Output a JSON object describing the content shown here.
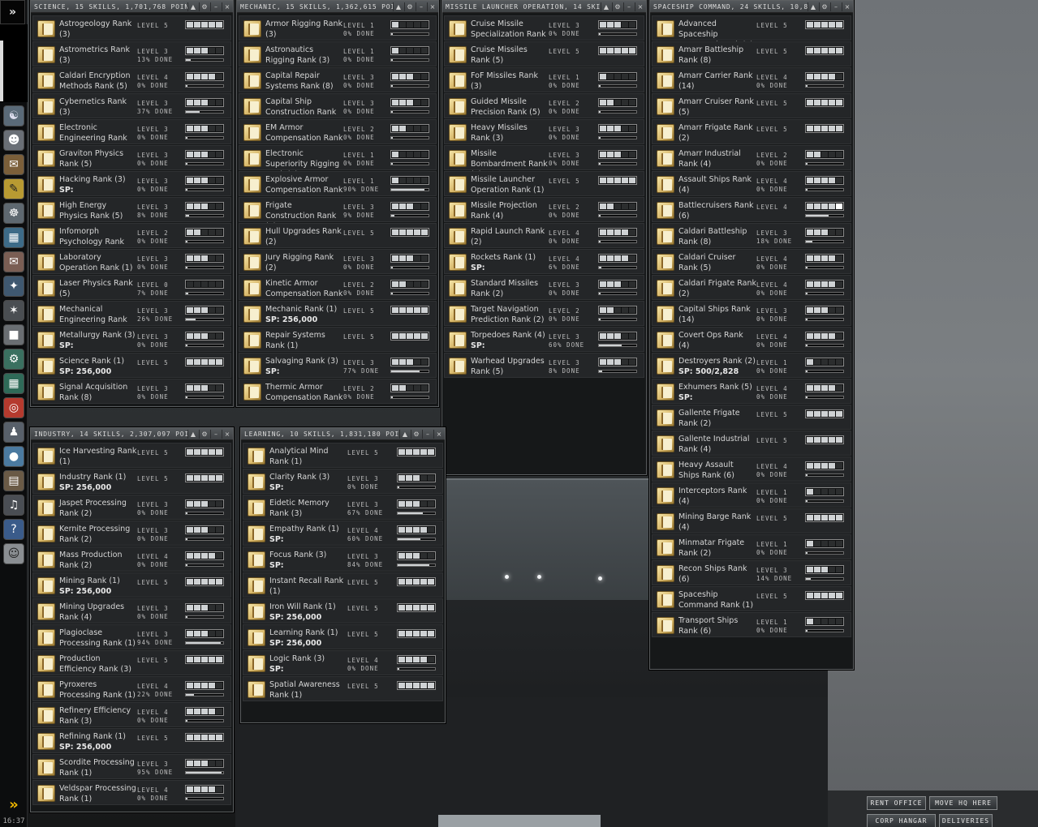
{
  "sidebar": {
    "toggle": "»",
    "clock": "16:37"
  },
  "hangar_buttons": {
    "rent_office": "RENT OFFICE",
    "move_hq": "MOVE HQ HERE",
    "corp_hangar": "CORP HANGAR",
    "deliveries": "DELIVERIES"
  },
  "windows": [
    {
      "key": "science",
      "title": "SCIENCE, 15 SKILLS, 1,701,768 POINTS",
      "skills": [
        {
          "name": "Astrogeology Rank (3)",
          "level": 5,
          "progress": null,
          "sp": null
        },
        {
          "name": "Astrometrics Rank (3)",
          "level": 3,
          "progress": 13,
          "sp": null
        },
        {
          "name": "Caldari Encryption Methods Rank (5)",
          "level": 4,
          "progress": 0,
          "sp": null
        },
        {
          "name": "Cybernetics Rank (3)",
          "level": 3,
          "progress": 37,
          "sp": null
        },
        {
          "name": "Electronic Engineering Rank",
          "level": 3,
          "progress": 0,
          "sp": null
        },
        {
          "name": "Graviton Physics Rank (5)",
          "level": 3,
          "progress": 0,
          "sp": null
        },
        {
          "name": "Hacking Rank (3)",
          "level": 3,
          "progress": 0,
          "sp": ""
        },
        {
          "name": "High Energy Physics Rank (5)",
          "level": 3,
          "progress": 8,
          "sp": null
        },
        {
          "name": "Infomorph Psychology Rank",
          "level": 2,
          "progress": 0,
          "sp": null
        },
        {
          "name": "Laboratory Operation Rank (1)",
          "level": 3,
          "progress": 0,
          "sp": null
        },
        {
          "name": "Laser Physics Rank (5)",
          "level": 0,
          "progress": 7,
          "sp": null
        },
        {
          "name": "Mechanical Engineering Rank",
          "level": 3,
          "progress": 26,
          "sp": null
        },
        {
          "name": "Metallurgy Rank (3)",
          "level": 3,
          "progress": 0,
          "sp": ""
        },
        {
          "name": "Science Rank (1)",
          "level": 5,
          "progress": null,
          "sp": "256,000"
        },
        {
          "name": "Signal Acquisition Rank (8)",
          "level": 3,
          "progress": 0,
          "sp": null
        }
      ]
    },
    {
      "key": "mechanic",
      "title": "MECHANIC, 15 SKILLS, 1,362,615 POINTS",
      "skills": [
        {
          "name": "Armor Rigging Rank (3)",
          "level": 1,
          "progress": 0,
          "sp": null
        },
        {
          "name": "Astronautics Rigging Rank (3)",
          "level": 1,
          "progress": 0,
          "sp": null
        },
        {
          "name": "Capital Repair Systems Rank (8)",
          "level": 3,
          "progress": 0,
          "sp": null
        },
        {
          "name": "Capital Ship Construction Rank",
          "level": 3,
          "progress": 0,
          "sp": null
        },
        {
          "name": "EM Armor Compensation Rank",
          "level": 2,
          "progress": 0,
          "sp": null
        },
        {
          "name": "Electronic Superiority Rigging Rank (3)",
          "level": 1,
          "progress": 0,
          "sp": null
        },
        {
          "name": "Explosive Armor Compensation Rank",
          "level": 1,
          "progress": 90,
          "sp": null
        },
        {
          "name": "Frigate Construction Rank (2)",
          "level": 3,
          "progress": 9,
          "sp": null
        },
        {
          "name": "Hull Upgrades Rank (2)",
          "level": 5,
          "progress": null,
          "sp": null
        },
        {
          "name": "Jury Rigging Rank (2)",
          "level": 3,
          "progress": 0,
          "sp": null
        },
        {
          "name": "Kinetic Armor Compensation Rank",
          "level": 2,
          "progress": 0,
          "sp": null
        },
        {
          "name": "Mechanic Rank (1)",
          "level": 5,
          "progress": null,
          "sp": "256,000"
        },
        {
          "name": "Repair Systems Rank (1)",
          "level": 5,
          "progress": null,
          "sp": null
        },
        {
          "name": "Salvaging Rank (3)",
          "level": 3,
          "progress": 77,
          "sp": ""
        },
        {
          "name": "Thermic Armor Compensation Rank",
          "level": 2,
          "progress": 0,
          "sp": null
        }
      ]
    },
    {
      "key": "missile",
      "title": "MISSILE LAUNCHER OPERATION, 14 SKILLS",
      "skills": [
        {
          "name": "Cruise Missile Specialization Rank",
          "level": 3,
          "progress": 0,
          "sp": null
        },
        {
          "name": "Cruise Missiles Rank (5)",
          "level": 5,
          "progress": null,
          "sp": null
        },
        {
          "name": "FoF Missiles Rank (3)",
          "level": 1,
          "progress": 0,
          "sp": null
        },
        {
          "name": "Guided Missile Precision Rank (5)",
          "level": 2,
          "progress": 0,
          "sp": null
        },
        {
          "name": "Heavy Missiles Rank (3)",
          "level": 3,
          "progress": 0,
          "sp": null
        },
        {
          "name": "Missile Bombardment Rank (2)",
          "level": 3,
          "progress": 0,
          "sp": null
        },
        {
          "name": "Missile Launcher Operation Rank (1)",
          "level": 5,
          "progress": null,
          "sp": null
        },
        {
          "name": "Missile Projection Rank (4)",
          "level": 2,
          "progress": 0,
          "sp": null
        },
        {
          "name": "Rapid Launch Rank (2)",
          "level": 4,
          "progress": 0,
          "sp": null
        },
        {
          "name": "Rockets Rank (1)",
          "level": 4,
          "progress": 6,
          "sp": ""
        },
        {
          "name": "Standard Missiles Rank (2)",
          "level": 3,
          "progress": 0,
          "sp": null
        },
        {
          "name": "Target Navigation Prediction Rank (2)",
          "level": 2,
          "progress": 0,
          "sp": null
        },
        {
          "name": "Torpedoes Rank (4)",
          "level": 3,
          "progress": 60,
          "sp": ""
        },
        {
          "name": "Warhead Upgrades Rank (5)",
          "level": 3,
          "progress": 8,
          "sp": null
        }
      ]
    },
    {
      "key": "spaceship",
      "title": "SPACESHIP COMMAND, 24 SKILLS, 10,8",
      "skills": [
        {
          "name": "Advanced Spaceship Command Rank (5)",
          "level": 5,
          "progress": null,
          "sp": null
        },
        {
          "name": "Amarr Battleship Rank (8)",
          "level": 5,
          "progress": null,
          "sp": null
        },
        {
          "name": "Amarr Carrier Rank (14)",
          "level": 4,
          "progress": 0,
          "sp": null
        },
        {
          "name": "Amarr Cruiser Rank (5)",
          "level": 5,
          "progress": null,
          "sp": null
        },
        {
          "name": "Amarr Frigate Rank (2)",
          "level": 5,
          "progress": null,
          "sp": null
        },
        {
          "name": "Amarr Industrial Rank (4)",
          "level": 2,
          "progress": 0,
          "sp": null
        },
        {
          "name": "Assault Ships Rank (4)",
          "level": 4,
          "progress": 0,
          "sp": null
        },
        {
          "name": "Battlecruisers Rank (6)",
          "level": 4,
          "progress": 60,
          "sp": null,
          "training": true
        },
        {
          "name": "Caldari Battleship Rank (8)",
          "level": 3,
          "progress": 18,
          "sp": null
        },
        {
          "name": "Caldari Cruiser Rank (5)",
          "level": 4,
          "progress": 0,
          "sp": null
        },
        {
          "name": "Caldari Frigate Rank (2)",
          "level": 4,
          "progress": 0,
          "sp": null
        },
        {
          "name": "Capital Ships Rank (14)",
          "level": 3,
          "progress": 0,
          "sp": null
        },
        {
          "name": "Covert Ops Rank (4)",
          "level": 4,
          "progress": 0,
          "sp": null
        },
        {
          "name": "Destroyers Rank (2)",
          "level": 1,
          "progress": 0,
          "sp": "500/2,828"
        },
        {
          "name": "Exhumers Rank (5)",
          "level": 4,
          "progress": 0,
          "sp": ""
        },
        {
          "name": "Gallente Frigate Rank (2)",
          "level": 5,
          "progress": null,
          "sp": null
        },
        {
          "name": "Gallente Industrial Rank (4)",
          "level": 5,
          "progress": null,
          "sp": null
        },
        {
          "name": "Heavy Assault Ships Rank (6)",
          "level": 4,
          "progress": 0,
          "sp": null
        },
        {
          "name": "Interceptors Rank (4)",
          "level": 1,
          "progress": 0,
          "sp": null
        },
        {
          "name": "Mining Barge Rank (4)",
          "level": 5,
          "progress": null,
          "sp": null
        },
        {
          "name": "Minmatar Frigate Rank (2)",
          "level": 1,
          "progress": 0,
          "sp": null
        },
        {
          "name": "Recon Ships Rank (6)",
          "level": 3,
          "progress": 14,
          "sp": null
        },
        {
          "name": "Spaceship Command Rank (1)",
          "level": 5,
          "progress": null,
          "sp": null
        },
        {
          "name": "Transport Ships Rank (6)",
          "level": 1,
          "progress": 0,
          "sp": null
        }
      ]
    },
    {
      "key": "industry",
      "title": "INDUSTRY, 14 SKILLS, 2,307,097 POINTS",
      "skills": [
        {
          "name": "Ice Harvesting Rank (1)",
          "level": 5,
          "progress": null,
          "sp": null
        },
        {
          "name": "Industry Rank (1)",
          "level": 5,
          "progress": null,
          "sp": "256,000"
        },
        {
          "name": "Jaspet Processing Rank (2)",
          "level": 3,
          "progress": 0,
          "sp": null
        },
        {
          "name": "Kernite Processing Rank (2)",
          "level": 3,
          "progress": 0,
          "sp": null
        },
        {
          "name": "Mass Production Rank (2)",
          "level": 4,
          "progress": 0,
          "sp": null
        },
        {
          "name": "Mining Rank (1)",
          "level": 5,
          "progress": null,
          "sp": "256,000"
        },
        {
          "name": "Mining Upgrades Rank (4)",
          "level": 3,
          "progress": 0,
          "sp": null
        },
        {
          "name": "Plagioclase Processing Rank (1)",
          "level": 3,
          "progress": 94,
          "sp": null
        },
        {
          "name": "Production Efficiency Rank (3)",
          "level": 5,
          "progress": null,
          "sp": null
        },
        {
          "name": "Pyroxeres Processing Rank (1)",
          "level": 4,
          "progress": 22,
          "sp": null
        },
        {
          "name": "Refinery Efficiency Rank (3)",
          "level": 4,
          "progress": 0,
          "sp": null
        },
        {
          "name": "Refining Rank (1)",
          "level": 5,
          "progress": null,
          "sp": "256,000"
        },
        {
          "name": "Scordite Processing Rank (1)",
          "level": 3,
          "progress": 95,
          "sp": null
        },
        {
          "name": "Veldspar Processing Rank (1)",
          "level": 4,
          "progress": 0,
          "sp": null
        }
      ]
    },
    {
      "key": "learning",
      "title": "LEARNING, 10 SKILLS, 1,831,180 POINTS",
      "skills": [
        {
          "name": "Analytical Mind Rank (1)",
          "level": 5,
          "progress": null,
          "sp": null
        },
        {
          "name": "Clarity Rank (3)",
          "level": 3,
          "progress": 0,
          "sp": ""
        },
        {
          "name": "Eidetic Memory Rank (3)",
          "level": 3,
          "progress": 67,
          "sp": null
        },
        {
          "name": "Empathy Rank (1)",
          "level": 4,
          "progress": 60,
          "sp": ""
        },
        {
          "name": "Focus Rank (3)",
          "level": 3,
          "progress": 84,
          "sp": ""
        },
        {
          "name": "Instant Recall Rank (1)",
          "level": 5,
          "progress": null,
          "sp": null
        },
        {
          "name": "Iron Will Rank (1)",
          "level": 5,
          "progress": null,
          "sp": "256,000"
        },
        {
          "name": "Learning Rank (1)",
          "level": 5,
          "progress": null,
          "sp": "256,000"
        },
        {
          "name": "Logic Rank (3)",
          "level": 4,
          "progress": 0,
          "sp": ""
        },
        {
          "name": "Spatial Awareness Rank (1)",
          "level": 5,
          "progress": null,
          "sp": null
        }
      ]
    }
  ],
  "labels": {
    "level": "LEVEL",
    "done": "DONE",
    "sp": "SP:"
  }
}
